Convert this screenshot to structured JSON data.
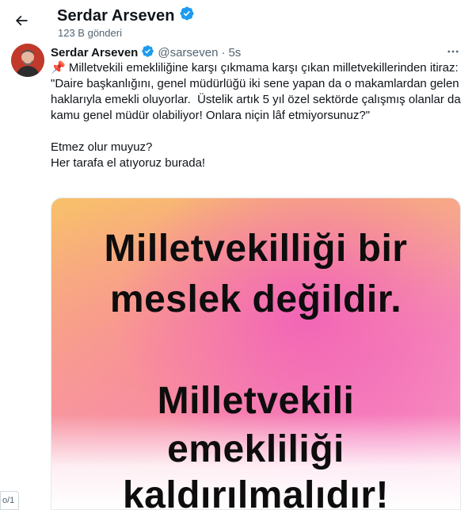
{
  "header": {
    "back_icon": "arrow-left-icon",
    "name": "Serdar Arseven",
    "verified_icon": "verified-badge-icon",
    "post_count": "123 B gönderi"
  },
  "post": {
    "author_name": "Serdar Arseven",
    "handle": "@sarseven",
    "separator": "·",
    "time": "5s",
    "more_icon": "more-horizontal-icon",
    "text": "📌 Milletvekili emekliliğine karşı çıkmama karşı çıkan milletvekillerinden itiraz:\n\"Daire başkanlığını, genel müdürlüğü iki sene yapan da o makamlardan gelen haklarıyla emekli oluyorlar.  Üstelik artık 5 yıl özel sektörde çalışmış olanlar da kamu genel müdür olabiliyor! Onlara niçin lâf etmiyorsunuz?\"\n\nEtmez olur muyuz?\nHer tarafa el atıyoruz burada!",
    "image_lines": [
      "Milletvekilliği bir",
      "meslek değildir.",
      "Milletvekili",
      "emekliliği",
      "kaldırılmalıdır!"
    ]
  },
  "page_indicator": "o/1",
  "colors": {
    "verified": "#1d9bf0",
    "secondary_text": "#536471",
    "primary_text": "#0f1419"
  }
}
